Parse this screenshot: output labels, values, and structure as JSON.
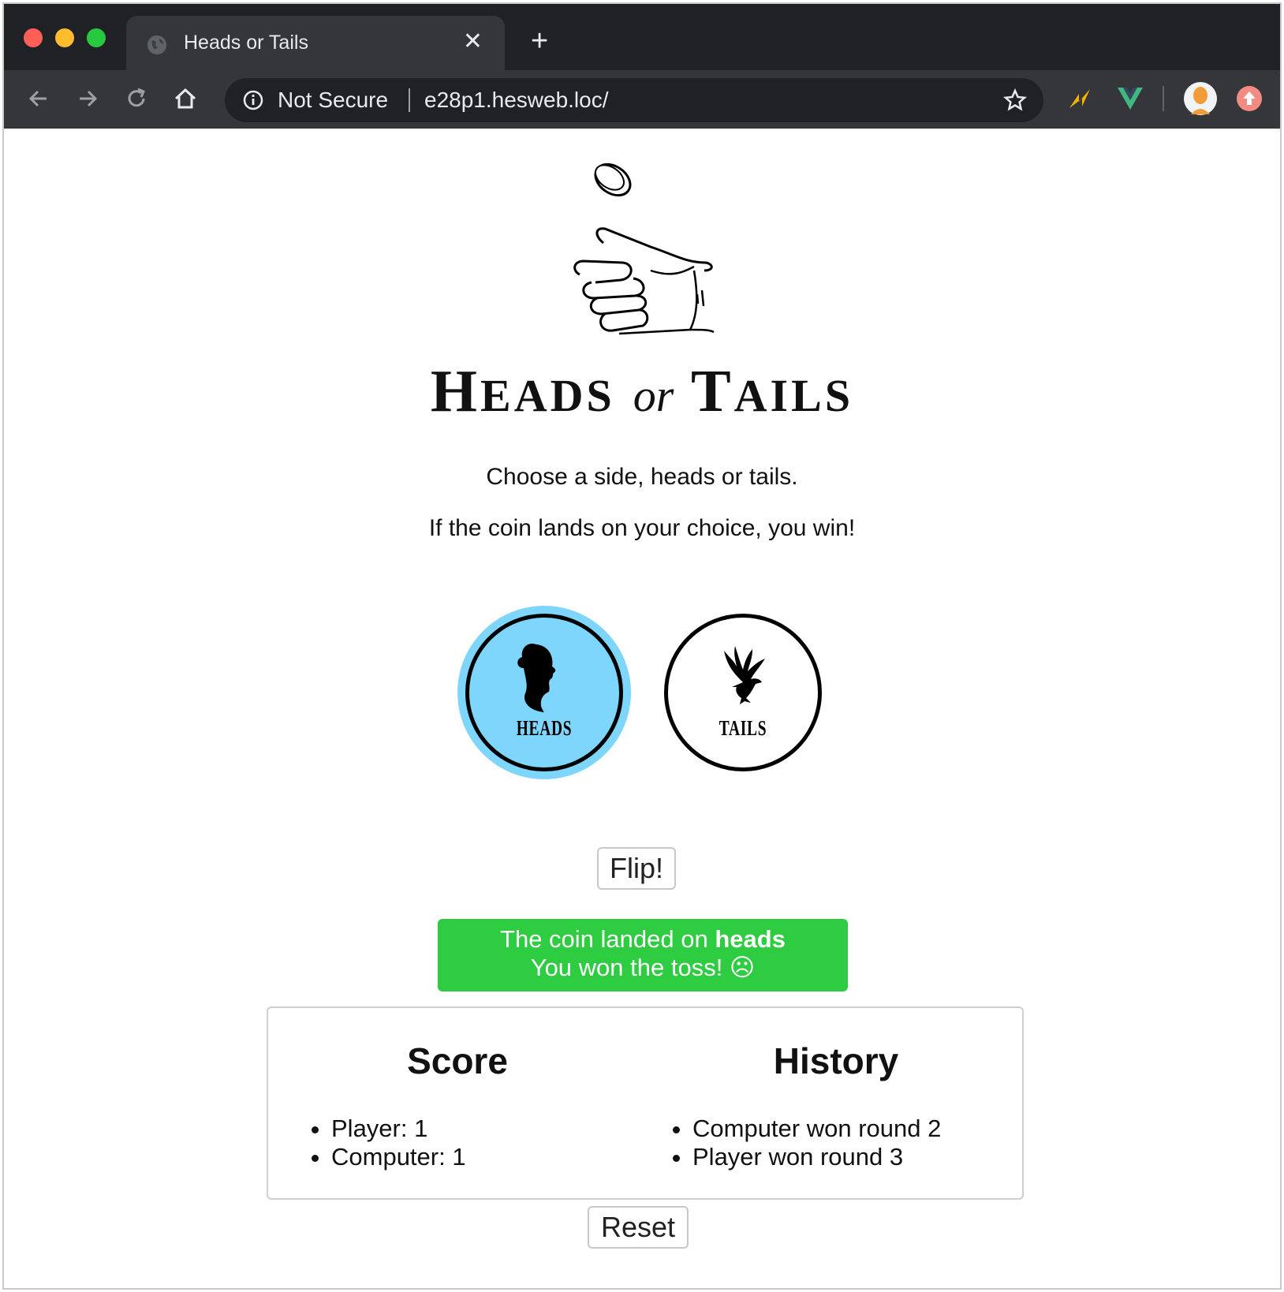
{
  "browser": {
    "tab_title": "Heads or Tails",
    "security_label": "Not Secure",
    "url": "e28p1.hesweb.loc/"
  },
  "header": {
    "title_parts": [
      "H",
      "EADS",
      "or",
      "T",
      "AILS"
    ]
  },
  "intro": {
    "line1": "Choose a side, heads or tails.",
    "line2": "If the coin lands on your choice, you win!"
  },
  "choices": [
    {
      "label": "HEADS",
      "selected": true,
      "icon": "woman-silhouette-icon"
    },
    {
      "label": "TAILS",
      "selected": false,
      "icon": "eagle-icon"
    }
  ],
  "flip_button": "Flip!",
  "result": {
    "line1_prefix": "The coin landed on",
    "line1_value": "heads",
    "line2": "You won the toss! ☹"
  },
  "score": {
    "heading": "Score",
    "items": [
      "Player: 1",
      "Computer: 1"
    ]
  },
  "history": {
    "heading": "History",
    "items": [
      "Computer won round 2",
      "Player won round 3"
    ]
  },
  "reset_button": "Reset",
  "colors": {
    "selected_coin": "#7fd6fd",
    "result_banner": "#2ecc40"
  }
}
